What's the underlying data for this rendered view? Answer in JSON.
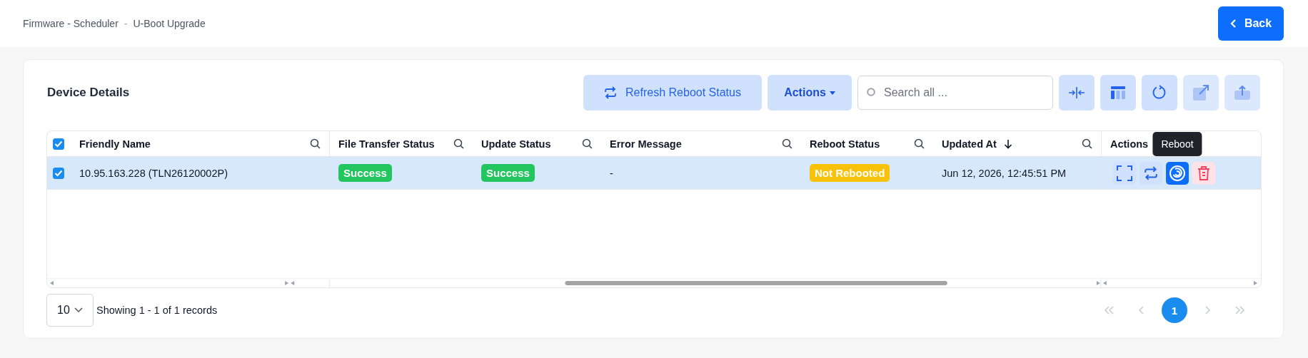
{
  "breadcrumb": {
    "items": [
      "Firmware - Scheduler",
      "U-Boot Upgrade"
    ],
    "separator": "-"
  },
  "back_button": {
    "label": "Back"
  },
  "card": {
    "title": "Device Details"
  },
  "toolbar": {
    "refresh_button": "Refresh Reboot Status",
    "actions_button": "Actions",
    "search": {
      "placeholder": "Search all ..."
    },
    "icon_buttons": [
      {
        "kind": "collapse",
        "disabled": false
      },
      {
        "kind": "columns",
        "disabled": false
      },
      {
        "kind": "reload",
        "disabled": false
      },
      {
        "kind": "open",
        "disabled": true
      },
      {
        "kind": "export",
        "disabled": true
      }
    ]
  },
  "table": {
    "all_checked": true,
    "columns": [
      {
        "label": "Friendly Name",
        "searchable": true,
        "sorted_desc": false
      },
      {
        "label": "File Transfer Status",
        "searchable": true,
        "sorted_desc": false
      },
      {
        "label": "Update Status",
        "searchable": true,
        "sorted_desc": false
      },
      {
        "label": "Error Message",
        "searchable": true,
        "sorted_desc": false
      },
      {
        "label": "Reboot Status",
        "searchable": true,
        "sorted_desc": false
      },
      {
        "label": "Updated At",
        "searchable": true,
        "sorted_desc": true
      },
      {
        "label": "Actions"
      }
    ],
    "rows": [
      {
        "checked": true,
        "selected": true,
        "friendly_name": "10.95.163.228 (TLN26120002P)",
        "file_transfer_status": {
          "text": "Success",
          "color": "#22c55e"
        },
        "update_status": {
          "text": "Success",
          "color": "#22c55e"
        },
        "error_message": "-",
        "reboot_status": {
          "text": "Not Rebooted",
          "color": "#f8c20a"
        },
        "updated_at": "Jun 12, 2026, 12:45:51 PM",
        "actions": [
          {
            "kind": "expand",
            "hovered": false
          },
          {
            "kind": "retry",
            "hovered": false
          },
          {
            "kind": "reboot",
            "hovered": true,
            "tooltip": "Reboot"
          },
          {
            "kind": "delete",
            "hovered": false
          }
        ]
      }
    ]
  },
  "footer": {
    "page_size": "10",
    "summary": "Showing 1 - 1 of 1 records",
    "pagination": [
      {
        "kind": "first",
        "disabled": true
      },
      {
        "kind": "prev",
        "disabled": true
      },
      {
        "kind": "page",
        "label": "1",
        "selected": true
      },
      {
        "kind": "next",
        "disabled": true
      },
      {
        "kind": "last",
        "disabled": true
      }
    ]
  }
}
